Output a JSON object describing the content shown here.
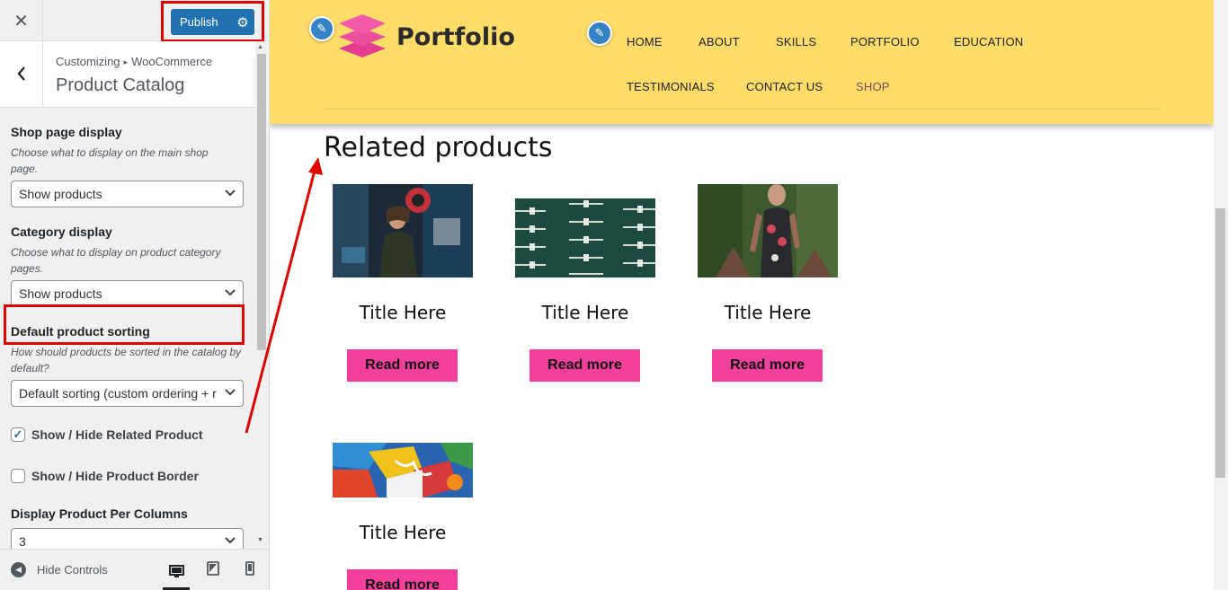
{
  "topbar": {
    "close_icon": "close-icon",
    "publish_label": "Publish",
    "publish_settings_icon": "gear-icon"
  },
  "panel": {
    "breadcrumb_root": "Customizing",
    "breadcrumb_section": "WooCommerce",
    "title": "Product Catalog"
  },
  "controls": {
    "shop_page_display": {
      "label": "Shop page display",
      "description": "Choose what to display on the main shop page.",
      "value": "Show products"
    },
    "category_display": {
      "label": "Category display",
      "description": "Choose what to display on product category pages.",
      "value": "Show products"
    },
    "default_sorting": {
      "label": "Default product sorting",
      "description": "How should products be sorted in the catalog by default?",
      "value": "Default sorting (custom ordering + r"
    },
    "related_product": {
      "label": "Show / Hide Related Product",
      "checked": true
    },
    "product_border": {
      "label": "Show / Hide Product Border",
      "checked": false
    },
    "per_columns": {
      "label": "Display Product Per Columns",
      "value": "3"
    }
  },
  "footer": {
    "hide_controls_label": "Hide Controls"
  },
  "site": {
    "logo_text": "Portfolio",
    "nav": [
      "HOME",
      "ABOUT",
      "SKILLS",
      "PORTFOLIO",
      "EDUCATION",
      "TESTIMONIALS",
      "CONTACT US",
      "SHOP"
    ],
    "active_nav": "SHOP",
    "related_heading": "Related products",
    "products": [
      {
        "title": "Title Here",
        "button": "Read more",
        "image": "graffiti-woman-photo"
      },
      {
        "title": "Title Here",
        "button": "Read more",
        "image": "green-wall-pattern-photo"
      },
      {
        "title": "Title Here",
        "button": "Read more",
        "image": "tattooed-woman-photo"
      },
      {
        "title": "Title Here",
        "button": "Read more",
        "image": "abstract-painting-photo"
      }
    ]
  },
  "colors": {
    "header_bg": "#ffdd68",
    "button_pink": "#f3409d",
    "wp_blue": "#2271b1",
    "annotation_red": "#e00000"
  }
}
